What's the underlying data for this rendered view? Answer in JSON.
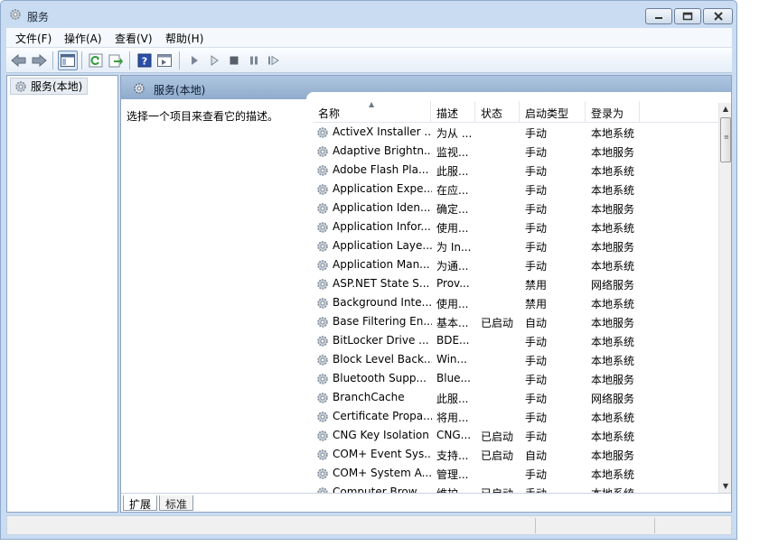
{
  "window": {
    "title": "服务"
  },
  "menu": [
    "文件(F)",
    "操作(A)",
    "查看(V)",
    "帮助(H)"
  ],
  "tree": {
    "root_label": "服务(本地)"
  },
  "main": {
    "header_title": "服务(本地)",
    "description_prompt": "选择一个项目来查看它的描述。",
    "columns": [
      "名称",
      "描述",
      "状态",
      "启动类型",
      "登录为"
    ],
    "rows": [
      {
        "name": "ActiveX Installer ...",
        "desc": "为从 ...",
        "status": "",
        "startup": "手动",
        "logon": "本地系统"
      },
      {
        "name": "Adaptive Brightn...",
        "desc": "监视...",
        "status": "",
        "startup": "手动",
        "logon": "本地服务"
      },
      {
        "name": "Adobe Flash Pla...",
        "desc": "此服...",
        "status": "",
        "startup": "手动",
        "logon": "本地系统"
      },
      {
        "name": "Application Expe...",
        "desc": "在应...",
        "status": "",
        "startup": "手动",
        "logon": "本地系统"
      },
      {
        "name": "Application Iden...",
        "desc": "确定...",
        "status": "",
        "startup": "手动",
        "logon": "本地服务"
      },
      {
        "name": "Application Infor...",
        "desc": "使用...",
        "status": "",
        "startup": "手动",
        "logon": "本地系统"
      },
      {
        "name": "Application Laye...",
        "desc": "为 In...",
        "status": "",
        "startup": "手动",
        "logon": "本地服务"
      },
      {
        "name": "Application Man...",
        "desc": "为通...",
        "status": "",
        "startup": "手动",
        "logon": "本地系统"
      },
      {
        "name": "ASP.NET State S...",
        "desc": "Prov...",
        "status": "",
        "startup": "禁用",
        "logon": "网络服务"
      },
      {
        "name": "Background Inte...",
        "desc": "使用...",
        "status": "",
        "startup": "禁用",
        "logon": "本地系统"
      },
      {
        "name": "Base Filtering En...",
        "desc": "基本...",
        "status": "已启动",
        "startup": "自动",
        "logon": "本地服务"
      },
      {
        "name": "BitLocker Drive ...",
        "desc": "BDE...",
        "status": "",
        "startup": "手动",
        "logon": "本地系统"
      },
      {
        "name": "Block Level Back...",
        "desc": "Win...",
        "status": "",
        "startup": "手动",
        "logon": "本地系统"
      },
      {
        "name": "Bluetooth Supp...",
        "desc": "Blue...",
        "status": "",
        "startup": "手动",
        "logon": "本地服务"
      },
      {
        "name": "BranchCache",
        "desc": "此服...",
        "status": "",
        "startup": "手动",
        "logon": "网络服务"
      },
      {
        "name": "Certificate Propa...",
        "desc": "将用...",
        "status": "",
        "startup": "手动",
        "logon": "本地系统"
      },
      {
        "name": "CNG Key Isolation",
        "desc": "CNG...",
        "status": "已启动",
        "startup": "手动",
        "logon": "本地系统"
      },
      {
        "name": "COM+ Event Sys...",
        "desc": "支持...",
        "status": "已启动",
        "startup": "自动",
        "logon": "本地服务"
      },
      {
        "name": "COM+ System A...",
        "desc": "管理...",
        "status": "",
        "startup": "手动",
        "logon": "本地系统"
      },
      {
        "name": "Computer Brow...",
        "desc": "维护...",
        "status": "已启动",
        "startup": "手动",
        "logon": "本地系统"
      }
    ]
  },
  "tabs": [
    "扩展",
    "标准"
  ],
  "colors": {
    "header_gradient_top": "#aec6e0",
    "header_gradient_bottom": "#8fabcd",
    "window_frame": "#c9dcf2",
    "pane_border": "#8da2bd"
  },
  "icons": {
    "service": "gear-icon",
    "back": "arrow-left-icon",
    "forward": "arrow-right-icon",
    "help": "help-icon",
    "play": "play-icon",
    "stop": "stop-icon",
    "pause": "pause-icon",
    "restart": "restart-icon"
  }
}
